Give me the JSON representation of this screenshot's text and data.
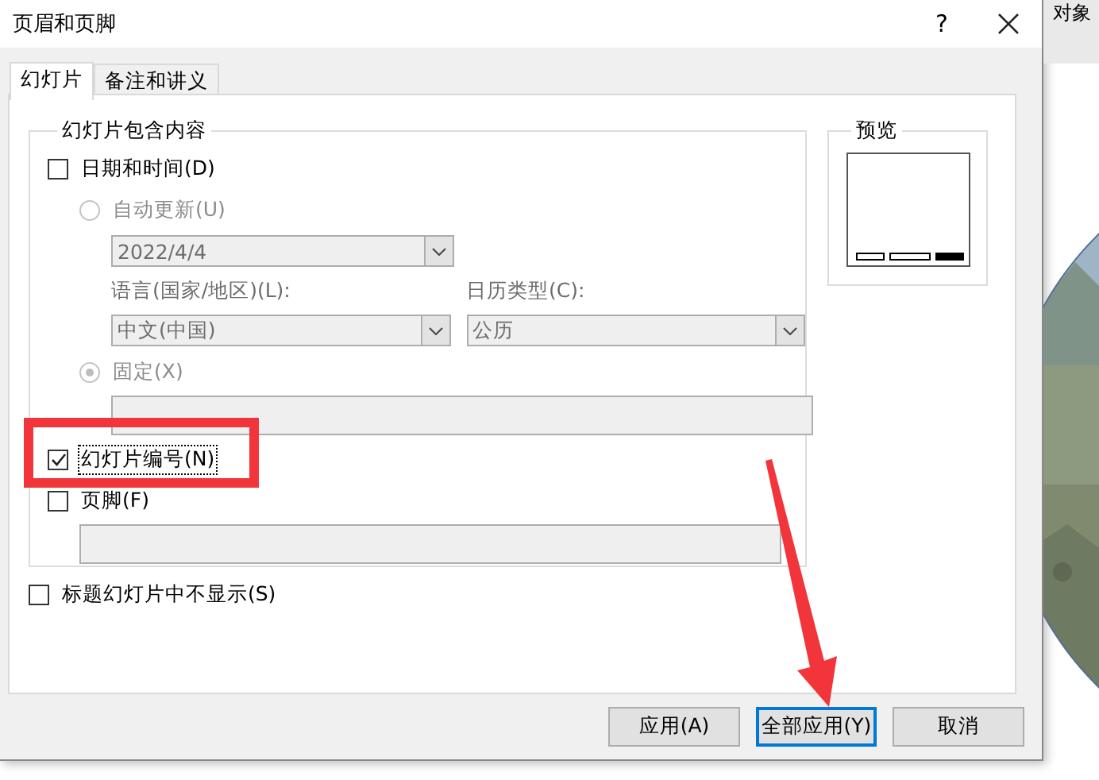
{
  "window": {
    "title": "页眉和页脚",
    "help": "?"
  },
  "tabs": [
    {
      "label": "幻灯片",
      "selected": true
    },
    {
      "label": "备注和讲义",
      "selected": false
    }
  ],
  "group": {
    "title": "幻灯片包含内容",
    "items": [
      {
        "kind": "checkbox",
        "label": "日期和时间(D)",
        "checked": false,
        "focused": false,
        "children": [
          {
            "kind": "radio",
            "label": "自动更新(U)",
            "selected": false,
            "disabled": true,
            "children": [
              {
                "kind": "dropdown-row",
                "dropdowns": [
                  {
                    "value": "2022/4/4",
                    "disabled": true
                  }
                ]
              },
              {
                "kind": "label-row",
                "labels": [
                  "语言(国家/地区)(L):",
                  "日历类型(C):"
                ]
              },
              {
                "kind": "dropdown-row",
                "dropdowns": [
                  {
                    "value": "中文(中国)",
                    "disabled": true
                  },
                  {
                    "value": "公历",
                    "disabled": true
                  }
                ]
              }
            ]
          },
          {
            "kind": "radio",
            "label": "固定(X)",
            "selected": true,
            "disabled": true,
            "children": [
              {
                "kind": "field",
                "disabled": true
              }
            ]
          }
        ]
      },
      {
        "kind": "checkbox",
        "label": "幻灯片编号(N)",
        "checked": true,
        "focused": true
      },
      {
        "kind": "checkbox",
        "label": "页脚(F)",
        "checked": false,
        "focused": false,
        "children": [
          {
            "kind": "field",
            "disabled": true
          }
        ]
      }
    ]
  },
  "below_group": [
    {
      "kind": "checkbox",
      "label": "标题幻灯片中不显示(S)",
      "checked": false,
      "focused": false
    }
  ],
  "preview": {
    "title": "预览",
    "placeholders": [
      {
        "active": false
      },
      {
        "active": false
      },
      {
        "active": true
      }
    ]
  },
  "buttons": [
    {
      "label": "应用(A)",
      "default": false
    },
    {
      "label": "全部应用(Y)",
      "default": true
    },
    {
      "label": "取消",
      "default": false
    }
  ],
  "background": {
    "text": "对象",
    "kind": "picture"
  },
  "annotations": [
    {
      "kind": "highlight-box"
    },
    {
      "kind": "arrow"
    }
  ]
}
